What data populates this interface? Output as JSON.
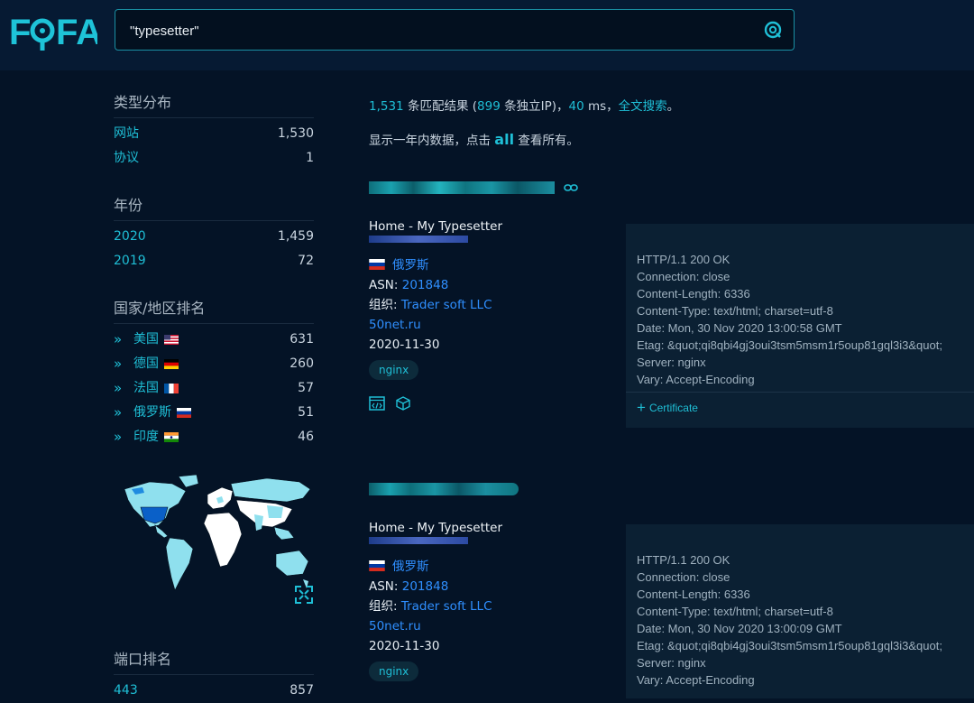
{
  "logo": "FOFA",
  "search": {
    "query": "\"typesetter\""
  },
  "summary": {
    "count": "1,531",
    "t1": " 条匹配结果 (",
    "ips": "899",
    "t2": " 条独立IP)，",
    "ms": "40",
    "t3": " ms，",
    "fulltext": "全文搜索",
    "t4": "。"
  },
  "note": {
    "prefix": "显示一年内数据，点击 ",
    "all": "all",
    "suffix": " 查看所有。"
  },
  "sidebar": {
    "type": {
      "title": "类型分布",
      "items": [
        {
          "label": "网站",
          "count": "1,530"
        },
        {
          "label": "协议",
          "count": "1"
        }
      ]
    },
    "year": {
      "title": "年份",
      "items": [
        {
          "label": "2020",
          "count": "1,459"
        },
        {
          "label": "2019",
          "count": "72"
        }
      ]
    },
    "country": {
      "title": "国家/地区排名",
      "items": [
        {
          "label": "美国",
          "count": "631"
        },
        {
          "label": "德国",
          "count": "260"
        },
        {
          "label": "法国",
          "count": "57"
        },
        {
          "label": "俄罗斯",
          "count": "51"
        },
        {
          "label": "印度",
          "count": "46"
        }
      ]
    },
    "port": {
      "title": "端口排名",
      "items": [
        {
          "label": "443",
          "count": "857"
        }
      ]
    }
  },
  "results": [
    {
      "title": "Home - My Typesetter",
      "country": "俄罗斯",
      "asn_label": "ASN: ",
      "asn": "201848",
      "org_label": "组织: ",
      "org": "Trader soft LLC",
      "domain": "50net.ru",
      "date": "2020-11-30",
      "tag": "nginx",
      "headers": [
        "HTTP/1.1 200 OK",
        "Connection: close",
        "Content-Length: 6336",
        "Content-Type: text/html; charset=utf-8",
        "Date: Mon, 30 Nov 2020 13:00:58 GMT",
        "Etag: &quot;qi8qbi4gj3oui3tsm5msm1r5oup81gql3i3&quot;",
        "Server: nginx",
        "Vary: Accept-Encoding"
      ],
      "certificate": "Certificate"
    },
    {
      "title": "Home - My Typesetter",
      "country": "俄罗斯",
      "asn_label": "ASN: ",
      "asn": "201848",
      "org_label": "组织: ",
      "org": "Trader soft LLC",
      "domain": "50net.ru",
      "date": "2020-11-30",
      "tag": "nginx",
      "headers": [
        "HTTP/1.1 200 OK",
        "Connection: close",
        "Content-Length: 6336",
        "Content-Type: text/html; charset=utf-8",
        "Date: Mon, 30 Nov 2020 13:00:09 GMT",
        "Etag: &quot;qi8qbi4gj3oui3tsm5msm1r5oup81gql3i3&quot;",
        "Server: nginx",
        "Vary: Accept-Encoding"
      ]
    }
  ],
  "icons": {
    "search": "search-icon",
    "code": "code-icon",
    "cube": "cube-icon",
    "expand": "expand-icon"
  },
  "colors": {
    "accent": "#1fbfd6",
    "link": "#2f8fff",
    "background": "#041326"
  }
}
